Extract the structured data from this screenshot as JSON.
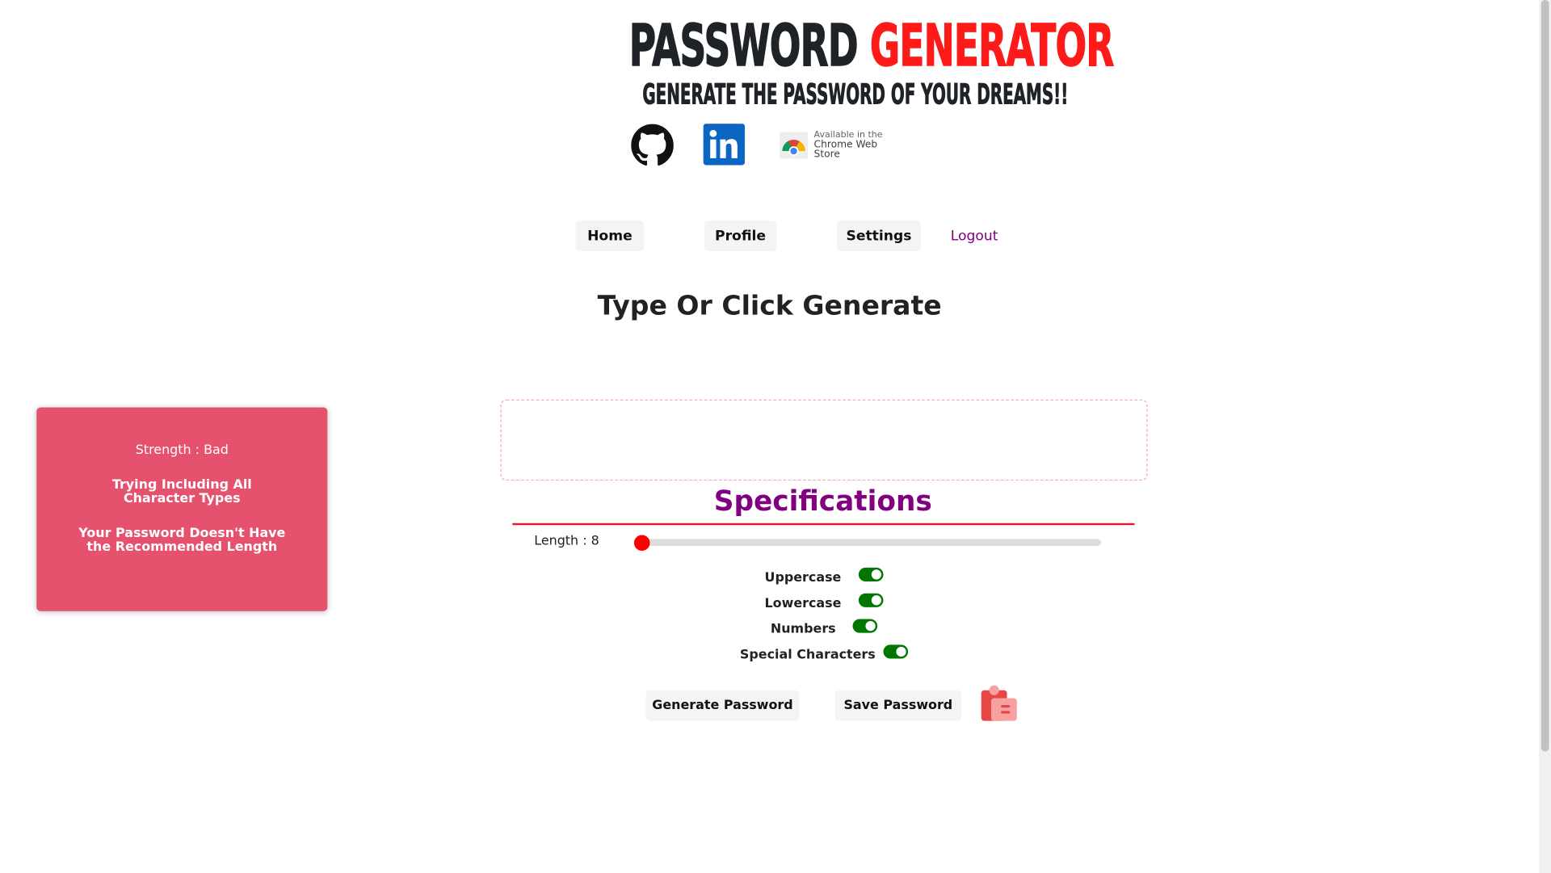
{
  "header": {
    "title_main": "PASSWORD",
    "title_accent": "GENERATOR",
    "subtitle": "GENERATE THE PASSWORD OF YOUR DREAMS!!",
    "social": {
      "github_icon": "github-icon",
      "linkedin_icon": "linkedin-icon",
      "chrome_store_line1": "Available in the",
      "chrome_store_line2": "Chrome Web Store"
    }
  },
  "nav": {
    "home": "Home",
    "profile": "Profile",
    "settings": "Settings",
    "logout": "Logout"
  },
  "main": {
    "heading": "Type Or Click Generate",
    "password_value": "",
    "specifications_title": "Specifications",
    "length_label": "Length : 8",
    "length_value": 8,
    "options": {
      "uppercase": "Uppercase",
      "lowercase": "Lowercase",
      "numbers": "Numbers",
      "special": "Special Characters"
    },
    "options_enabled": {
      "uppercase": true,
      "lowercase": true,
      "numbers": true,
      "special": true
    },
    "generate_button": "Generate Password",
    "save_button": "Save Password",
    "clipboard_icon": "clipboard-icon"
  },
  "strength_panel": {
    "strength": "Strength : Bad",
    "tip1": "Trying Including All Character Types",
    "tip2": "Your Password Doesn't Have the Recommended Length"
  },
  "colors": {
    "accent_red": "#ff1a1a",
    "purple": "#800080",
    "panel_pink": "#e6526e",
    "toggle_green": "#007700"
  }
}
